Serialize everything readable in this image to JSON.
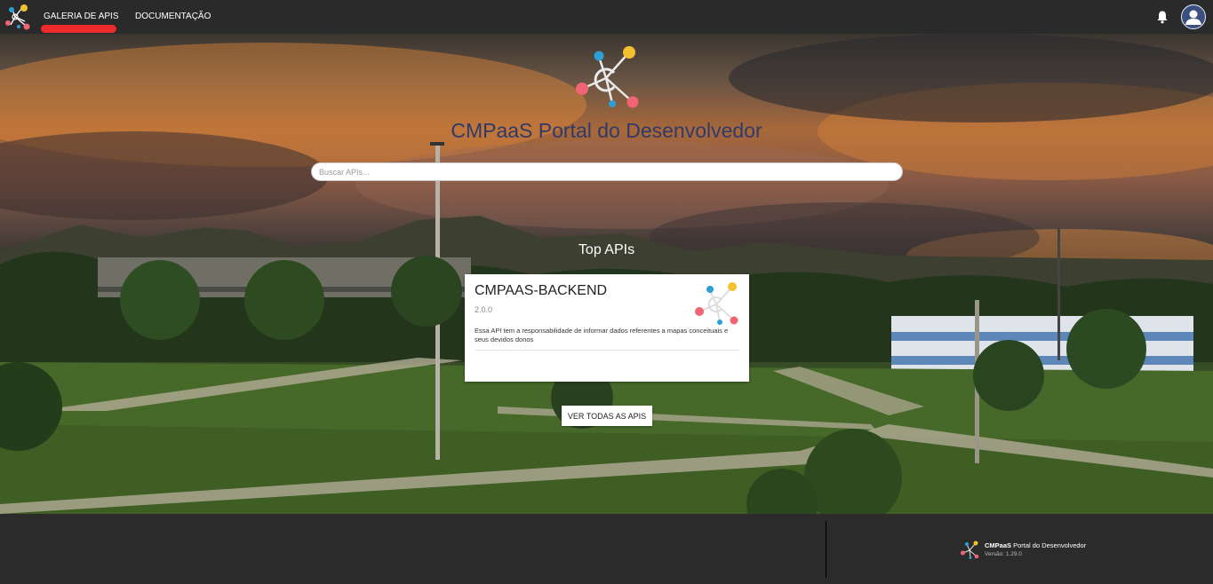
{
  "nav": {
    "items": [
      {
        "label": "GALERIA DE APIS",
        "active": true
      },
      {
        "label": "DOCUMENTAÇÃO",
        "active": false
      }
    ],
    "icons": [
      "logo-icon",
      "bell-icon",
      "user-avatar-icon"
    ],
    "active_underline_color": "#ee2a2a"
  },
  "hero": {
    "title": "CMPaaS Portal do Desenvolvedor",
    "search": {
      "placeholder": "Buscar APIs...",
      "value": ""
    },
    "top_apis_title": "Top APIs",
    "view_all_label": "VER TODAS AS APIS"
  },
  "apis": [
    {
      "name": "CMPAAS-BACKEND",
      "version": "2.0.0",
      "description": "Essa API tem a responsabilidade de informar dados referentes a mapas conceituais e seus devidos donos"
    }
  ],
  "footer": {
    "brand_bold": "CMPaaS",
    "brand_rest": " Portal do Desenvolvedor",
    "version": "Versão: 1.29.0"
  },
  "colors": {
    "logo_yellow": "#f2c12e",
    "logo_blue": "#2b9fd6",
    "logo_pink": "#f06473",
    "title": "#2f3a6a",
    "topbar": "#2a2a2a",
    "footer": "#2b2b2b"
  }
}
